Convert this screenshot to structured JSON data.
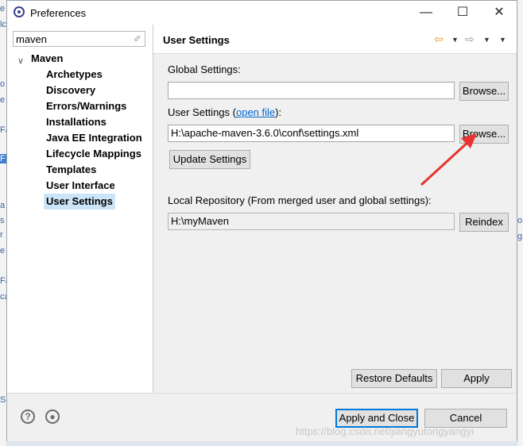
{
  "window": {
    "title": "Preferences",
    "controls": {
      "minimize": "—",
      "maximize": "☐",
      "close": "✕"
    }
  },
  "filter": {
    "value": "maven"
  },
  "tree": {
    "root": "Maven",
    "children": [
      "Archetypes",
      "Discovery",
      "Errors/Warnings",
      "Installations",
      "Java EE Integration",
      "Lifecycle Mappings",
      "Templates",
      "User Interface",
      "User Settings"
    ],
    "selected": "User Settings"
  },
  "page": {
    "title": "User Settings",
    "global_label": "Global Settings:",
    "global_value": "",
    "browse": "Browse...",
    "user_label_pre": "User Settings (",
    "user_label_link": "open file",
    "user_label_post": "):",
    "user_value": "H:\\apache-maven-3.6.0\\conf\\settings.xml",
    "update": "Update Settings",
    "local_label": "Local Repository (From merged user and global settings):",
    "local_value": "H:\\myMaven",
    "reindex": "Reindex",
    "restore": "Restore Defaults",
    "apply": "Apply"
  },
  "footer": {
    "apply_close": "Apply and Close",
    "cancel": "Cancel"
  },
  "watermark": "https://blog.csdn.net/jiangyutongyangyi",
  "colors": {
    "selection": "#cce4f7",
    "arrow": "#e8332f",
    "link": "#0066cc",
    "default_button_border": "#0078d7"
  }
}
